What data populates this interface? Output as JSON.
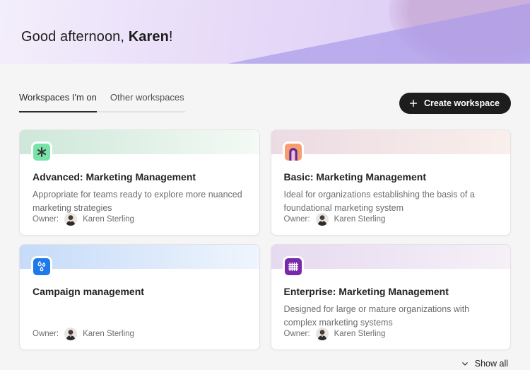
{
  "greeting": {
    "prefix": "Good afternoon, ",
    "name": "Karen",
    "suffix": "!"
  },
  "tabs": [
    {
      "label": "Workspaces I'm on",
      "active": true
    },
    {
      "label": "Other workspaces",
      "active": false
    }
  ],
  "toolbar": {
    "create_workspace_label": "Create workspace"
  },
  "cards": [
    {
      "title": "Advanced: Marketing Management",
      "description": "Appropriate for teams ready to explore more nuanced marketing strategies",
      "owner_label": "Owner:",
      "owner_name": "Karen Sterling",
      "icon": "asterisk-icon",
      "icon_bg": "#79e2a8",
      "band_gradient": [
        "#cee7d9",
        "#f4faf5"
      ]
    },
    {
      "title": "Basic: Marketing Management",
      "description": "Ideal for organizations establishing the basis of a foundational marketing system",
      "owner_label": "Owner:",
      "owner_name": "Karen Sterling",
      "icon": "rainbow-arch-icon",
      "icon_bg": "#f69e70",
      "band_gradient": [
        "#ecdbe3",
        "#f9efeb"
      ]
    },
    {
      "title": "Campaign management",
      "description": "",
      "owner_label": "Owner:",
      "owner_name": "Karen Sterling",
      "icon": "raindrops-icon",
      "icon_bg": "#2079e8",
      "band_gradient": [
        "#c5dbf8",
        "#eff5fd"
      ]
    },
    {
      "title": "Enterprise: Marketing Management",
      "description": "Designed for large or mature organizations with complex marketing systems",
      "owner_label": "Owner:",
      "owner_name": "Karen Sterling",
      "icon": "hash-grid-icon",
      "icon_bg": "#7a28ad",
      "band_gradient": [
        "#e6daf0",
        "#f6f0f7"
      ]
    }
  ],
  "footer": {
    "show_all_label": "Show all"
  },
  "colors": {
    "page_background": "#f5f5f5",
    "hero_gradient_start": "#f3eefb",
    "hero_gradient_end": "#d9c8f4",
    "hero_triangle": "#ab9ce9",
    "hero_corner_blob": "#c9abd8",
    "create_button_background": "#1d1d1d",
    "active_tab_underline": "#2b2b2b",
    "tab_rail": "#e2e2e2",
    "card_border": "#e4e2e6",
    "title_text": "#242424",
    "secondary_text": "#6d6d6d"
  }
}
